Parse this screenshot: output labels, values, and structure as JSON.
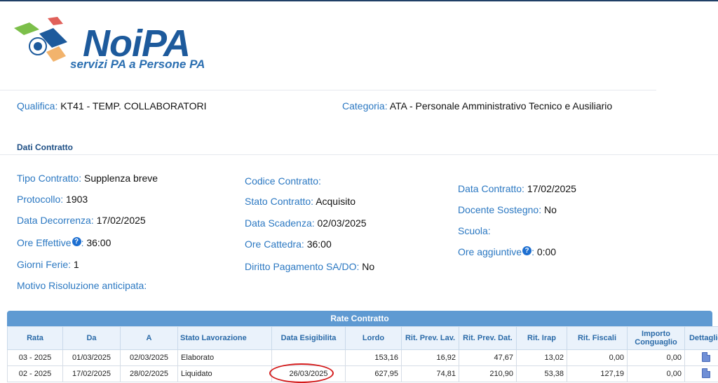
{
  "brand": {
    "name": "NoiPA",
    "tagline": "servizi PA a Persone PA",
    "colors": {
      "primary": "#1d5a9c",
      "accent_green": "#7cbf4a",
      "accent_red": "#e0605a",
      "accent_orange": "#f2b36c"
    }
  },
  "header": {
    "qualifica_label": "Qualifica:",
    "qualifica_value": "KT41 - TEMP. COLLABORATORI",
    "categoria_label": "Categoria:",
    "categoria_value": "ATA - Personale Amministrativo Tecnico e Ausiliario"
  },
  "section_title": "Dati Contratto",
  "contract": {
    "col1": [
      {
        "label": "Tipo Contratto:",
        "value": "Supplenza breve"
      },
      {
        "label": "Protocollo:",
        "value": "1903"
      },
      {
        "label": "Data Decorrenza:",
        "value": "17/02/2025"
      },
      {
        "label": "Ore Effettive",
        "value": "36:00",
        "help": true
      },
      {
        "label": "Giorni Ferie:",
        "value": "1"
      },
      {
        "label": "Motivo Risoluzione anticipata:",
        "value": ""
      }
    ],
    "col2": [
      {
        "label": "Codice Contratto:",
        "value": ""
      },
      {
        "label": "Stato Contratto:",
        "value": "Acquisito"
      },
      {
        "label": "Data Scadenza:",
        "value": "02/03/2025"
      },
      {
        "label": "Ore Cattedra:",
        "value": "36:00"
      },
      {
        "label": "Diritto Pagamento SA/DO:",
        "value": "No"
      }
    ],
    "col3": [
      {
        "label": "Data Contratto:",
        "value": "17/02/2025"
      },
      {
        "label": "Docente Sostegno:",
        "value": "No"
      },
      {
        "label": "Scuola:",
        "value": ""
      },
      {
        "label": "Ore aggiuntive",
        "value": "0:00",
        "help": true
      }
    ],
    "help_glyph": "?"
  },
  "rate_table": {
    "title": "Rate Contratto",
    "headers": [
      "Rata",
      "Da",
      "A",
      "Stato Lavorazione",
      "Data Esigibilita",
      "Lordo",
      "Rit. Prev. Lav.",
      "Rit. Prev. Dat.",
      "Rit. Irap",
      "Rit. Fiscali",
      "Importo Conguaglio",
      "Dettaglio"
    ],
    "rows": [
      [
        "03 - 2025",
        "01/03/2025",
        "02/03/2025",
        "Elaborato",
        "",
        "153,16",
        "16,92",
        "47,67",
        "13,02",
        "0,00",
        "0,00"
      ],
      [
        "02 - 2025",
        "17/02/2025",
        "28/02/2025",
        "Liquidato",
        "26/03/2025",
        "627,95",
        "74,81",
        "210,90",
        "53,38",
        "127,19",
        "0,00"
      ]
    ],
    "detail_icon": "document-icon"
  }
}
